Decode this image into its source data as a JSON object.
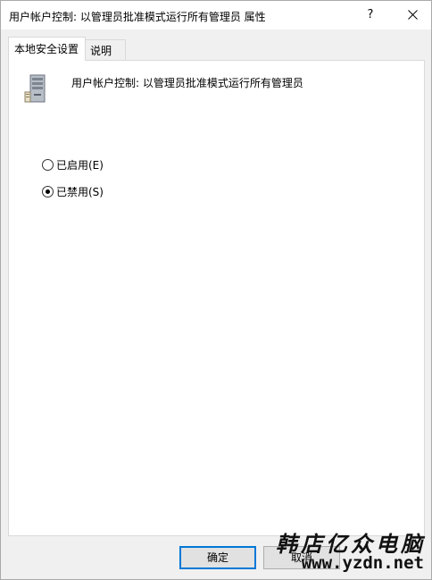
{
  "window": {
    "title": "用户帐户控制: 以管理员批准模式运行所有管理员 属性",
    "help_label": "?",
    "close_icon": "close-icon"
  },
  "tabs": [
    {
      "label": "本地安全设置",
      "active": true
    },
    {
      "label": "说明",
      "active": false
    }
  ],
  "policy": {
    "icon": "server-icon",
    "name": "用户帐户控制: 以管理员批准模式运行所有管理员"
  },
  "options": [
    {
      "label": "已启用(E)",
      "selected": false
    },
    {
      "label": "已禁用(S)",
      "selected": true
    }
  ],
  "buttons": {
    "ok": "确定",
    "cancel": "取消"
  },
  "watermark": {
    "title": "韩店亿众电脑",
    "url": "www.yzdn.net"
  },
  "colors": {
    "accent": "#0078d7",
    "window_bg": "#f0f0f0",
    "panel_bg": "#ffffff"
  }
}
